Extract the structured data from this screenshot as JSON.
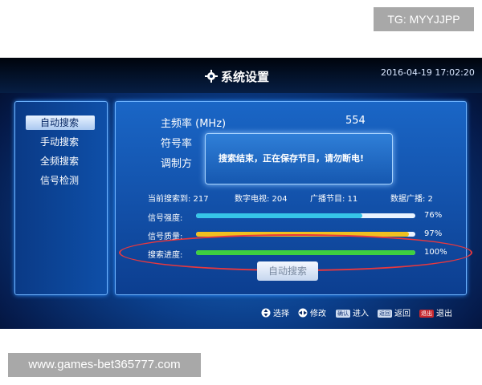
{
  "watermark_top": "TG: MYYJJPP",
  "watermark_bottom": "www.games-bet365777.com",
  "header": {
    "title": "系统设置",
    "datetime": "2016-04-19 17:02:20"
  },
  "menu": [
    {
      "label": "自动搜索",
      "active": true
    },
    {
      "label": "手动搜索",
      "active": false
    },
    {
      "label": "全频搜索",
      "active": false
    },
    {
      "label": "信号检测",
      "active": false
    }
  ],
  "fields": [
    {
      "label": "主频率 (MHz)",
      "value": "554"
    },
    {
      "label": "符号率",
      "value": ""
    },
    {
      "label": "调制方",
      "value": ""
    }
  ],
  "popup": {
    "message": "搜索结束，正在保存节目，请勿断电!"
  },
  "stats": {
    "searched": "当前搜索到: 217",
    "tv": "数字电视: 204",
    "radio": "广播节目: 11",
    "data": "数据广播: 2"
  },
  "bars": [
    {
      "label": "信号强度:",
      "percent": 76,
      "pct_text": "76%",
      "color": "#36c6e8"
    },
    {
      "label": "信号质量:",
      "percent": 97,
      "pct_text": "97%",
      "color": "#f0c020"
    },
    {
      "label": "搜索进度:",
      "percent": 100,
      "pct_text": "100%",
      "color": "#3ed040"
    }
  ],
  "button": {
    "label": "自动搜索"
  },
  "hints": {
    "select": "选择",
    "modify": "修改",
    "enter_key": "确认",
    "enter": "进入",
    "back_key": "返回",
    "back": "返回",
    "exit_key": "退出",
    "exit": "退出"
  }
}
